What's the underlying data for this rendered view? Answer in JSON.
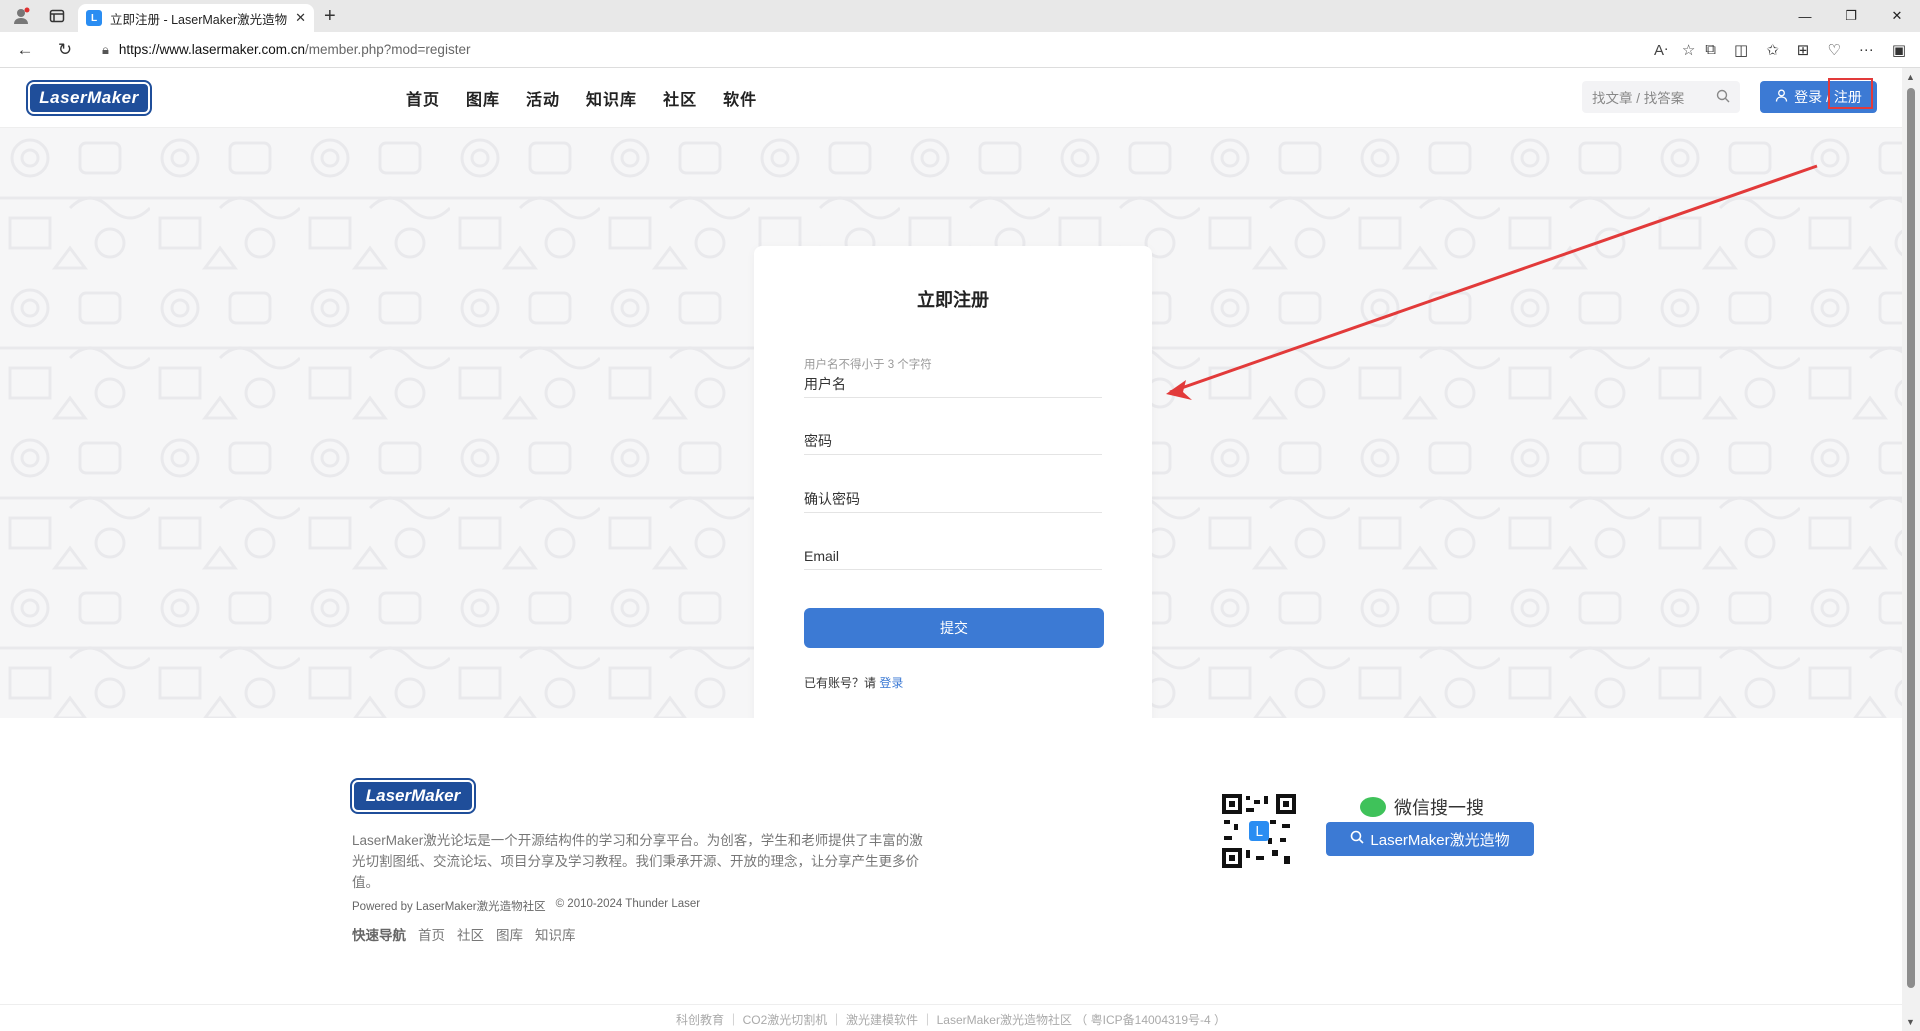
{
  "browser": {
    "tab_title": "立即注册 - LaserMaker激光造物",
    "tab_favicon": "L",
    "url_host": "https://www.lasermaker.com.cn",
    "url_path": "/member.php?mod=register"
  },
  "header": {
    "logo_text": "LaserMaker",
    "nav": [
      "首页",
      "图库",
      "活动",
      "知识库",
      "社区",
      "软件"
    ],
    "search_placeholder": "找文章 / 找答案",
    "login_label": "登录 / 注册"
  },
  "form": {
    "title": "立即注册",
    "username_hint": "用户名不得小于 3 个字符",
    "username_placeholder": "用户名",
    "password_placeholder": "密码",
    "confirm_placeholder": "确认密码",
    "email_placeholder": "Email",
    "submit_label": "提交",
    "have_account_text": "已有账号？请",
    "login_link": "登录"
  },
  "footer": {
    "logo_text": "LaserMaker",
    "description": "LaserMaker激光论坛是一个开源结构件的学习和分享平台。为创客，学生和老师提供了丰富的激光切割图纸、交流论坛、项目分享及学习教程。我们秉承开源、开放的理念，让分享产生更多价值。",
    "powered_by": "Powered by LaserMaker激光造物社区",
    "copyright": "© 2010-2024 Thunder Laser",
    "quick_nav_label": "快速导航",
    "quick_nav": [
      "首页",
      "社区",
      "图库",
      "知识库"
    ],
    "wechat_title": "微信搜一搜",
    "wechat_button": "LaserMaker激光造物",
    "bottom_links": "科创教育 ｜ CO2激光切割机 ｜ 激光建模软件 ｜ LaserMaker激光造物社区 （ 粤ICP备14004319号-4 ）"
  },
  "colors": {
    "accent": "#3c7ad4",
    "logo_bg": "#1f4e9a",
    "annotation": "#e23a3a"
  }
}
